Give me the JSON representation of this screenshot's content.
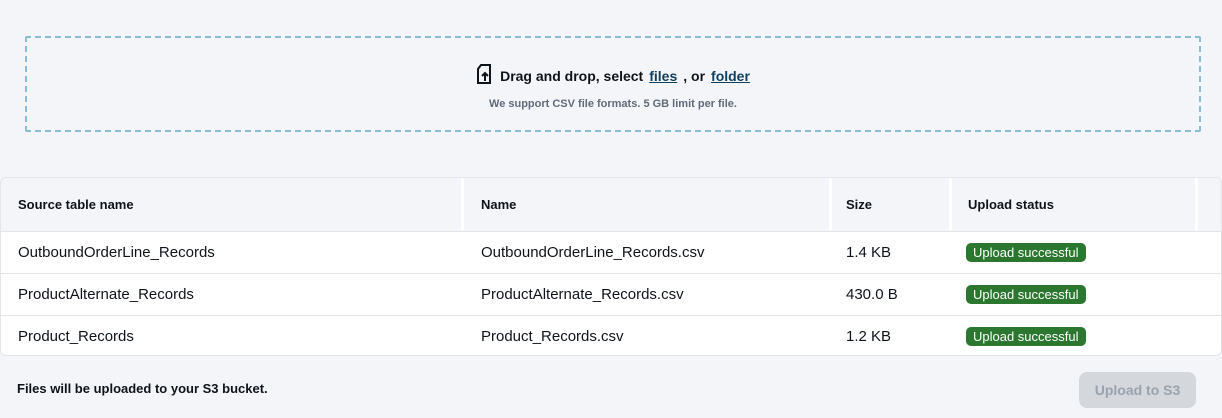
{
  "dropzone": {
    "text_prefix": "Drag and drop, select",
    "files_link": "files",
    "separator": ", or",
    "folder_link": "folder",
    "hint": "We support CSV file formats. 5 GB limit per file."
  },
  "table": {
    "columns": [
      "Source table name",
      "Name",
      "Size",
      "Upload status"
    ],
    "rows": [
      {
        "source": "OutboundOrderLine_Records",
        "name": "OutboundOrderLine_Records.csv",
        "size": "1.4 KB",
        "status": "Upload successful"
      },
      {
        "source": "ProductAlternate_Records",
        "name": "ProductAlternate_Records.csv",
        "size": "430.0 B",
        "status": "Upload successful"
      },
      {
        "source": "Product_Records",
        "name": "Product_Records.csv",
        "size": "1.2 KB",
        "status": "Upload successful"
      }
    ]
  },
  "footer": {
    "note": "Files will be uploaded to your S3 bucket.",
    "upload_button": "Upload to S3"
  }
}
